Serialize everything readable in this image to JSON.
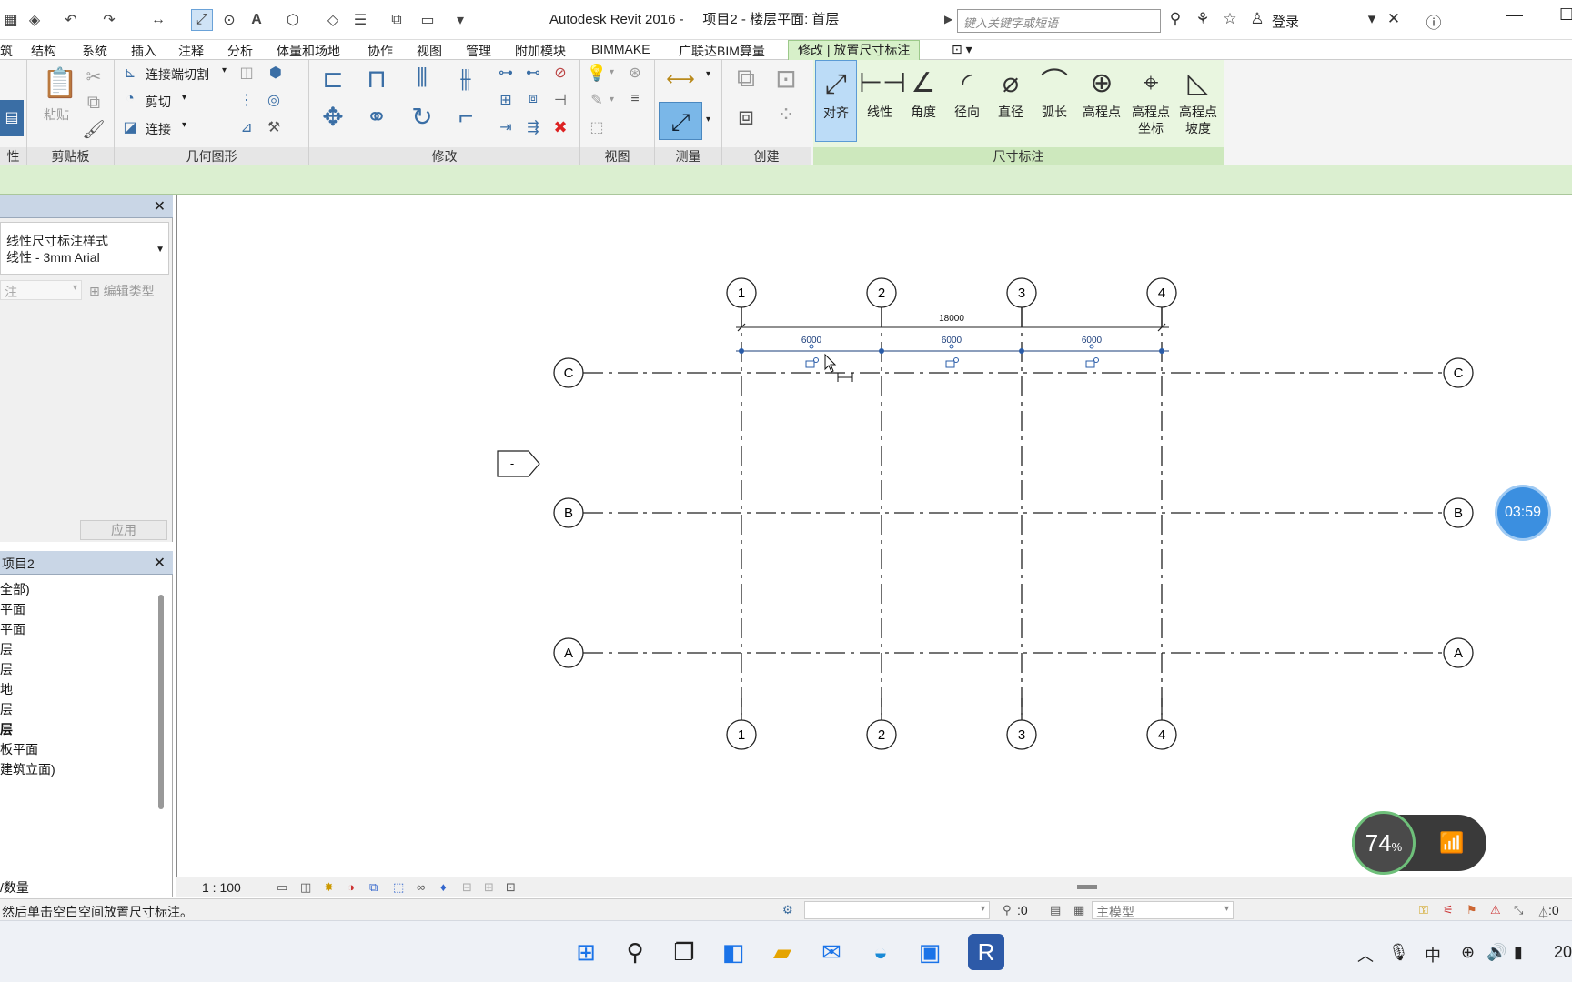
{
  "title_bar": {
    "app_title": "Autodesk Revit 2016 -     项目2 - 楼层平面: 首层",
    "search_placeholder": "键入关键字或短语",
    "login": "登录"
  },
  "menu_tabs": [
    "筑",
    "结构",
    "系统",
    "插入",
    "注释",
    "分析",
    "体量和场地",
    "协作",
    "视图",
    "管理",
    "附加模块",
    "BIMMAKE",
    "广联达BIM算量",
    "修改 | 放置尺寸标注"
  ],
  "ribbon": {
    "groups": {
      "properties": "性",
      "clipboard": "剪贴板",
      "geometry": "几何图形",
      "modify": "修改",
      "view": "视图",
      "measure": "测量",
      "create": "创建",
      "dimension": "尺寸标注"
    },
    "paste_label": "粘贴",
    "geometry_items": [
      "连接端切割",
      "剪切",
      "连接"
    ],
    "dimension_tools": [
      {
        "label": "对齐",
        "icon": "aligned-dimension-icon"
      },
      {
        "label": "线性",
        "icon": "linear-dimension-icon"
      },
      {
        "label": "角度",
        "icon": "angular-dimension-icon"
      },
      {
        "label": "径向",
        "icon": "radial-dimension-icon"
      },
      {
        "label": "直径",
        "icon": "diameter-dimension-icon"
      },
      {
        "label": "弧长",
        "icon": "arc-length-dimension-icon"
      },
      {
        "label": "高程点",
        "icon": "spot-elevation-icon"
      },
      {
        "label": "高程点\n坐标",
        "icon": "spot-coordinate-icon"
      },
      {
        "label": "高程点\n坡度",
        "icon": "spot-slope-icon"
      }
    ]
  },
  "properties_panel": {
    "type_line1": "线性尺寸标注样式",
    "type_line2": "线性 - 3mm Arial",
    "instance_selector": "注",
    "edit_type": "编辑类型",
    "apply": "应用"
  },
  "project_browser": {
    "title": "项目2",
    "items": [
      "全部)",
      "平面",
      "平面",
      "层",
      "层",
      "地",
      "层",
      "层",
      "板平面",
      "建筑立面)"
    ],
    "footer": "/数量"
  },
  "drawing": {
    "grid_columns": [
      "1",
      "2",
      "3",
      "4"
    ],
    "grid_rows": [
      "C",
      "B",
      "A"
    ],
    "overall_dimension": "18000",
    "segment_dimensions": [
      "6000",
      "6000",
      "6000"
    ],
    "section_mark": "-"
  },
  "view_bar": {
    "scale": "1 : 100"
  },
  "status_bar": {
    "message": "然后单击空白空间放置尺寸标注。",
    "count": ":0",
    "model": "主模型",
    "filter": ":0"
  },
  "overlays": {
    "timer": "03:59",
    "network_percent": "74",
    "percent_sign": "%"
  },
  "taskbar": {
    "ime": "中",
    "time_partial": "20"
  },
  "colors": {
    "accent": "#3b8fe0",
    "ribbon_context_tab": "#d7f0c9",
    "dimension_line": "#1a3c7a"
  }
}
